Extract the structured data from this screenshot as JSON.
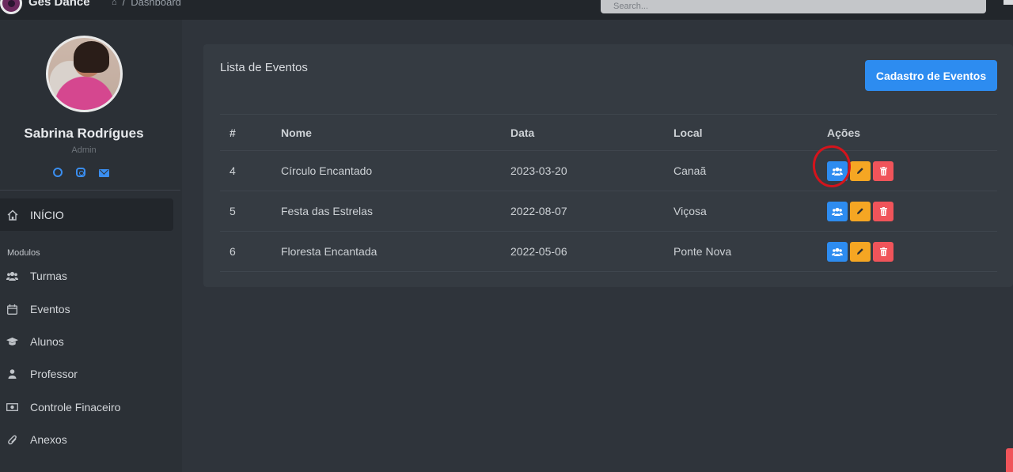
{
  "app": {
    "name": "Ges Dance"
  },
  "breadcrumb": {
    "current": "Dashboard"
  },
  "search": {
    "placeholder": "Search..."
  },
  "profile": {
    "name": "Sabrina Rodrígues",
    "role": "Admin",
    "socials": [
      "whatsapp-icon",
      "instagram-icon",
      "envelope-icon"
    ]
  },
  "sidebar": {
    "home_label": "INÍCIO",
    "section_label": "Modulos",
    "items": [
      {
        "label": "Turmas",
        "icon": "users-icon"
      },
      {
        "label": "Eventos",
        "icon": "calendar-icon"
      },
      {
        "label": "Alunos",
        "icon": "graduation-cap-icon"
      },
      {
        "label": "Professor",
        "icon": "user-icon"
      },
      {
        "label": "Controle Finaceiro",
        "icon": "money-icon"
      },
      {
        "label": "Anexos",
        "icon": "paperclip-icon"
      }
    ]
  },
  "main": {
    "card_title": "Lista de Eventos",
    "add_button_label": "Cadastro de Eventos",
    "table": {
      "headers": [
        "#",
        "Nome",
        "Data",
        "Local",
        "Ações"
      ],
      "rows": [
        {
          "id": "4",
          "nome": "Círculo Encantado",
          "data": "2023-03-20",
          "local": "Canaã"
        },
        {
          "id": "5",
          "nome": "Festa das Estrelas",
          "data": "2022-08-07",
          "local": "Viçosa"
        },
        {
          "id": "6",
          "nome": "Floresta Encantada",
          "data": "2022-05-06",
          "local": "Ponte Nova"
        }
      ]
    }
  },
  "colors": {
    "accent": "#2d8cf0",
    "edit": "#f5a623",
    "delete": "#f0545a",
    "annotation": "#d4141c"
  }
}
